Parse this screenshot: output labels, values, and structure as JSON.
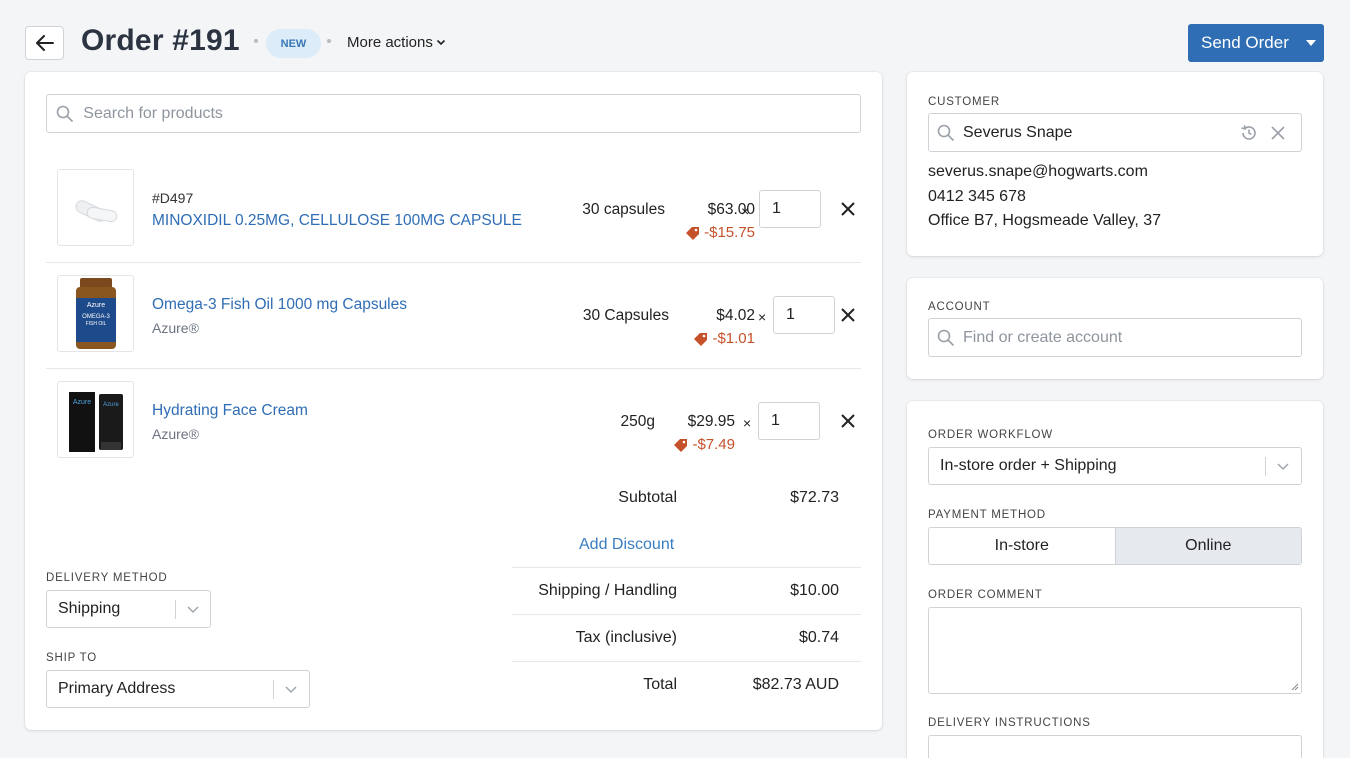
{
  "header": {
    "back_icon": "arrow-left-icon",
    "title": "Order #191",
    "status_badge": "NEW",
    "more_actions": "More actions",
    "send_button": "Send Order"
  },
  "search": {
    "placeholder": "Search for products"
  },
  "items": [
    {
      "sku": "#D497",
      "name": "MINOXIDIL 0.25MG, CELLULOSE 100MG CAPSULE",
      "brand": "",
      "size": "30 capsules",
      "price": "$63.00",
      "times": "×",
      "discount": "-$15.75",
      "qty": "1",
      "image": "capsule-image"
    },
    {
      "sku": "",
      "name": "Omega-3 Fish Oil 1000 mg Capsules",
      "brand": "Azure®",
      "size": "30 Capsules",
      "price": "$4.02",
      "times": "×",
      "discount": "-$1.01",
      "qty": "1",
      "image": "bottle-image",
      "image_text": [
        "Azure",
        "OMEGA-3",
        "FISH OIL"
      ]
    },
    {
      "sku": "",
      "name": "Hydrating Face Cream",
      "brand": "Azure®",
      "size": "250g",
      "price": "$29.95",
      "times": "×",
      "discount": "-$7.49",
      "qty": "1",
      "image": "cream-tube-image",
      "image_text": [
        "Azure",
        "Azure"
      ]
    }
  ],
  "totals": {
    "subtotal_label": "Subtotal",
    "subtotal_value": "$72.73",
    "add_discount": "Add Discount",
    "shipping_label": "Shipping / Handling",
    "shipping_value": "$10.00",
    "tax_label": "Tax (inclusive)",
    "tax_value": "$0.74",
    "total_label": "Total",
    "total_value": "$82.73 AUD"
  },
  "delivery": {
    "method_label": "DELIVERY METHOD",
    "method_value": "Shipping",
    "ship_to_label": "SHIP TO",
    "ship_to_value": "Primary Address"
  },
  "customer": {
    "label": "CUSTOMER",
    "name": "Severus Snape",
    "email": "severus.snape@hogwarts.com",
    "phone": "0412 345 678",
    "address": "Office B7, Hogsmeade Valley, 37"
  },
  "account": {
    "label": "ACCOUNT",
    "placeholder": "Find or create account"
  },
  "workflow": {
    "label": "ORDER WORKFLOW",
    "value": "In-store order + Shipping",
    "payment_label": "PAYMENT METHOD",
    "payment_options": [
      "In-store",
      "Online"
    ],
    "payment_selected": "Online",
    "comment_label": "ORDER COMMENT",
    "delivery_instructions_label": "DELIVERY INSTRUCTIONS"
  },
  "colors": {
    "accent": "#2f6db5",
    "link": "#2f6db5",
    "discount": "#c5512a",
    "badge_bg": "#dcecf9"
  }
}
